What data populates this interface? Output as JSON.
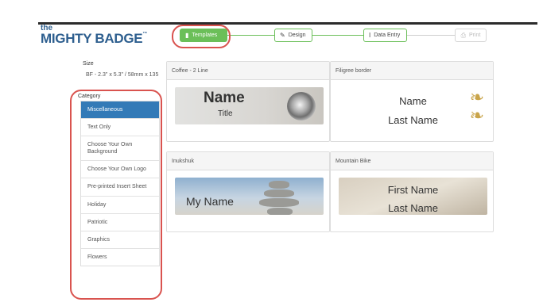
{
  "brand": {
    "the": "the",
    "name": "MIGHTY BADGE",
    "tm": "™"
  },
  "steps": [
    {
      "label": "Templates",
      "icon": "page-icon",
      "state": "active"
    },
    {
      "label": "Design",
      "icon": "pencil-icon",
      "state": "enabled"
    },
    {
      "label": "Data Entry",
      "icon": "text-cursor-icon",
      "state": "enabled"
    },
    {
      "label": "Print",
      "icon": "printer-icon",
      "state": "disabled"
    }
  ],
  "size": {
    "label": "Size",
    "value": "BF - 2.3\" x 5.3\" / 58mm x 135"
  },
  "category": {
    "label": "Category",
    "items": [
      "Miscellaneous",
      "Text Only",
      "Choose Your Own Background",
      "Choose Your Own Logo",
      "Pre-printed Insert Sheet",
      "Holiday",
      "Patriotic",
      "Graphics",
      "Flowers"
    ],
    "selected": "Miscellaneous"
  },
  "templates": [
    {
      "title": "Coffee - 2 Line",
      "line1": "Name",
      "line2": "Title"
    },
    {
      "title": "Filigree border",
      "line1": "Name",
      "line2": "Last Name"
    },
    {
      "title": "Inukshuk",
      "line1": "My Name"
    },
    {
      "title": "Mountain Bike",
      "line1": "First Name",
      "line2": "Last Name"
    }
  ],
  "colors": {
    "accent": "#6bbf59",
    "selected": "#337ab7",
    "highlight_ring": "#d9534f",
    "brand": "#2e5f8f"
  }
}
